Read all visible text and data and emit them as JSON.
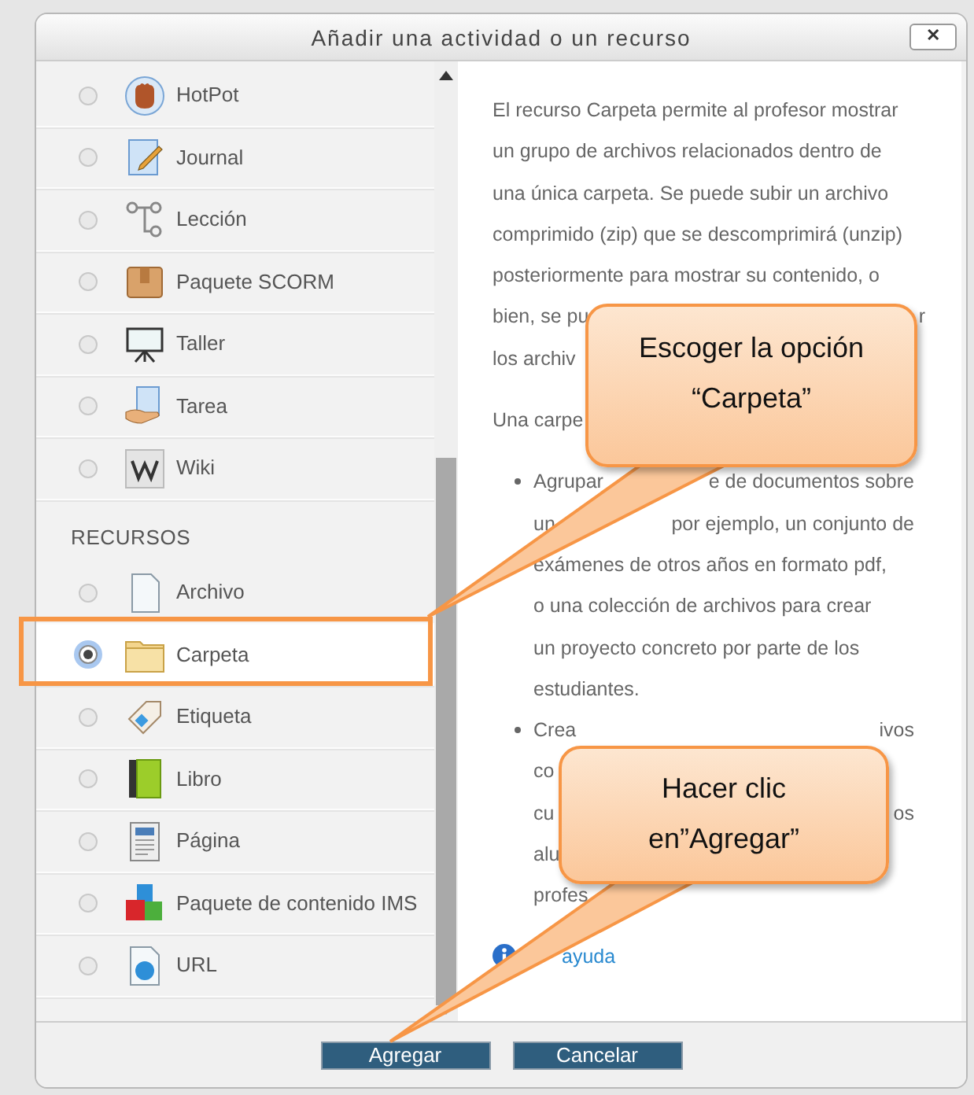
{
  "window": {
    "title": "Añadir una actividad o un recurso",
    "close_label": "✕"
  },
  "sections": [
    {
      "items": [
        {
          "label": "HotPot",
          "selected": false
        },
        {
          "label": "Journal",
          "selected": false
        },
        {
          "label": "Lección",
          "selected": false
        },
        {
          "label": "Paquete SCORM",
          "selected": false
        },
        {
          "label": "Taller",
          "selected": false
        },
        {
          "label": "Tarea",
          "selected": false
        },
        {
          "label": "Wiki",
          "selected": false
        }
      ]
    },
    {
      "heading": "RECURSOS",
      "items": [
        {
          "label": "Archivo",
          "selected": false
        },
        {
          "label": "Carpeta",
          "selected": true
        },
        {
          "label": "Etiqueta",
          "selected": false
        },
        {
          "label": "Libro",
          "selected": false
        },
        {
          "label": "Página",
          "selected": false
        },
        {
          "label": "Paquete de contenido IMS",
          "selected": false
        },
        {
          "label": "URL",
          "selected": false
        }
      ]
    }
  ],
  "description": [
    {
      "kind": "para",
      "lines": [
        [
          "El recurso Carpeta permite al profesor mostrar"
        ],
        [
          "un grupo de archivos relacionados dentro de"
        ],
        [
          "una única carpeta. Se puede subir un archivo"
        ],
        [
          "comprimido (zip) que se descomprimirá (unzip)"
        ],
        [
          "posteriormente para mostrar su contenido, o"
        ],
        [
          "bien, se pu",
          "r"
        ],
        [
          "los archiv"
        ]
      ]
    },
    {
      "kind": "para",
      "lines": [
        [
          "Una carpe"
        ]
      ]
    },
    {
      "kind": "bullet",
      "lines": [
        [
          "Agrupar",
          "e de documentos sobre"
        ],
        [
          "un",
          "por ejemplo, un conjunto de"
        ],
        [
          "exámenes de otros años en formato pdf,"
        ],
        [
          "o una colección de archivos para crear"
        ],
        [
          "un proyecto concreto por parte de los"
        ],
        [
          "estudiantes."
        ]
      ]
    },
    {
      "kind": "bullet",
      "lines": [
        [
          "Crea",
          "ivos"
        ],
        [
          "co"
        ],
        [
          "cu",
          "os"
        ],
        [
          "alu"
        ],
        [
          "profes"
        ]
      ]
    }
  ],
  "help_link": "ayuda",
  "buttons": [
    "Agregar",
    "Cancelar"
  ],
  "callouts": [
    {
      "text": "Escoger la opción “Carpeta”"
    },
    {
      "text": "Hacer clic en”Agregar”"
    }
  ]
}
